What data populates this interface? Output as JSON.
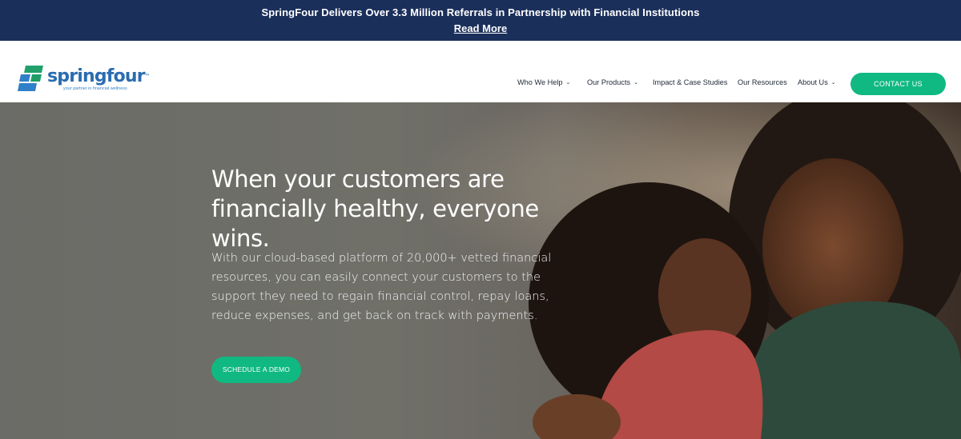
{
  "announcement": {
    "headline": "SpringFour Delivers Over 3.3 Million Referrals in Partnership with Financial Institutions",
    "link_label": "Read More"
  },
  "header": {
    "logo_text": "springfour",
    "logo_trademark": "™",
    "logo_tagline": "your partner in financial wellness",
    "nav": [
      {
        "label": "Who We Help",
        "has_dropdown": true
      },
      {
        "label": "Our Products",
        "has_dropdown": true
      },
      {
        "label": "Impact & Case Studies",
        "has_dropdown": false
      },
      {
        "label": "Our Resources",
        "has_dropdown": false
      },
      {
        "label": "About Us",
        "has_dropdown": true
      }
    ],
    "cta_label": "CONTACT US"
  },
  "hero": {
    "title_line1": "When your customers are",
    "title_line2": "financially healthy, everyone wins.",
    "body": "With our cloud-based platform of 20,000+ vetted financial resources, you can easily connect your customers to the support they need to regain financial control, repay loans, reduce expenses, and get back on track with payments.",
    "cta_label": "SCHEDULE A DEMO"
  },
  "icons": {
    "chevron": "chevron-down-icon",
    "logo_mark": "springfour-logo-icon"
  },
  "colors": {
    "announce_bg": "#1b2f5b",
    "accent_green": "#10b981",
    "logo_blue": "#2b6cb0"
  }
}
